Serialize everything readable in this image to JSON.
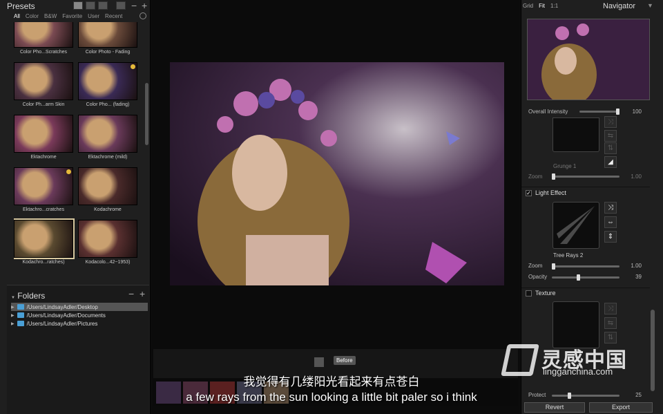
{
  "left": {
    "title": "Presets",
    "filters": [
      "All",
      "Color",
      "B&W",
      "Favorite",
      "User",
      "Recent"
    ],
    "presets": [
      {
        "label": "Color Pho...Scratches",
        "bg": "#7a4a52"
      },
      {
        "label": "Color Photo - Fading",
        "bg": "#6a4a3a"
      },
      {
        "label": "Color Ph...arm Skin",
        "bg": "#4a3040"
      },
      {
        "label": "Color Pho... (fading)",
        "bg": "#3a2a55",
        "star": true
      },
      {
        "label": "Ektachrome",
        "bg": "#7a3a5a"
      },
      {
        "label": "Ektachrome (mild)",
        "bg": "#6a3a5a"
      },
      {
        "label": "Ektachro...cratches",
        "bg": "#6a3a5a",
        "star": true
      },
      {
        "label": "Kodachrome",
        "bg": "#4a2a2a"
      },
      {
        "label": "Kodachro...ratches)",
        "bg": "#5a4a30",
        "selected": true
      },
      {
        "label": "Kodacolo...42~1953)",
        "bg": "#5a3030"
      }
    ],
    "folders_title": "Folders",
    "folders": [
      "/Users/LindsayAdler/Desktop",
      "/Users/LindsayAdler/Documents",
      "/Users/LindsayAdler/Pictures"
    ]
  },
  "center": {
    "before_label": "Before"
  },
  "subtitles": {
    "cn": "我觉得有几缕阳光看起来有点苍白",
    "en": "a few rays from the sun looking a little bit paler so i think"
  },
  "right": {
    "zoom_opts": [
      "Grid",
      "Fit",
      "1:1"
    ],
    "nav_title": "Navigator",
    "overall_label": "Overall Intensity",
    "overall_value": 100,
    "overall_frac": 1.0,
    "grunge_name": "Grunge 1",
    "zoom_label": "Zoom",
    "zoom1_value": "1.00",
    "zoom1_frac": 0.0,
    "light_title": "Light Effect",
    "light_preset": "Tree Rays 2",
    "zoom2_value": "1.00",
    "zoom2_frac": 0.0,
    "opacity_label": "Opacity",
    "opacity_value": 39,
    "opacity_frac": 0.39,
    "texture_title": "Texture",
    "protect_label": "Protect",
    "protect_value": 25,
    "protect_frac": 0.25,
    "revert": "Revert",
    "export": "Export"
  },
  "watermark": {
    "cn": "灵感中国",
    "en": "lingganchina.com"
  }
}
